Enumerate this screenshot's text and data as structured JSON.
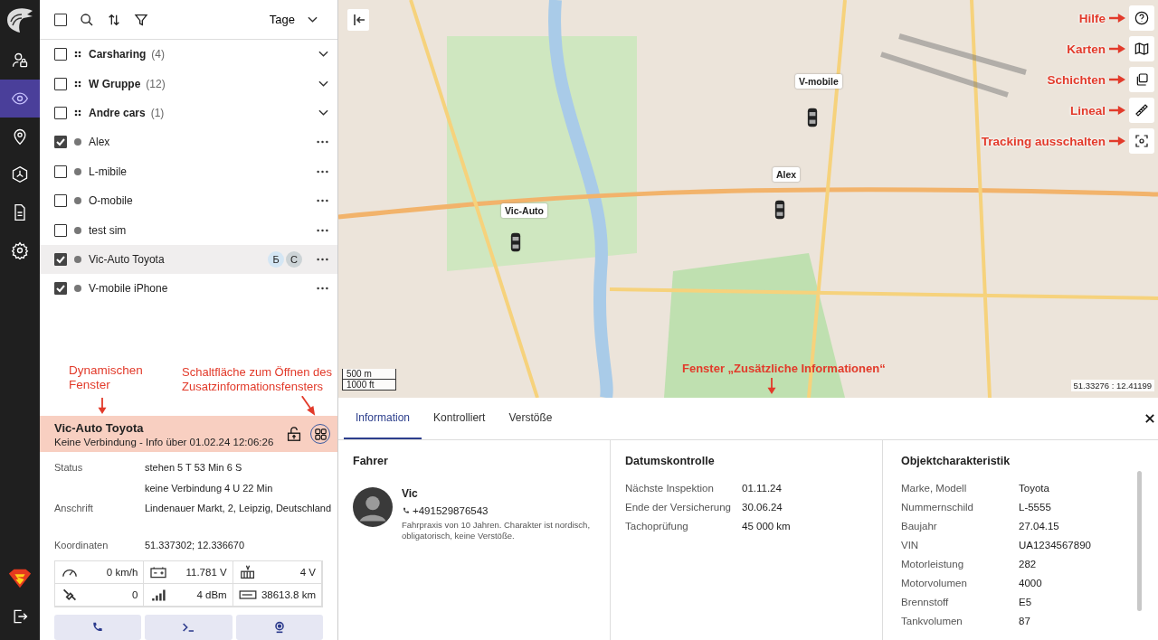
{
  "rail": [
    {
      "kind": "user-lock",
      "selected": false
    },
    {
      "kind": "eye",
      "selected": true
    },
    {
      "kind": "pin",
      "selected": false
    },
    {
      "kind": "hexagon",
      "selected": false
    },
    {
      "kind": "document",
      "selected": false
    },
    {
      "kind": "gear",
      "selected": false
    }
  ],
  "toolbar": {
    "period": "Tage",
    "select_all_checked": false
  },
  "list": [
    {
      "kind": "group",
      "name": "Carsharing",
      "count": "(4)",
      "checked": false,
      "selected": false
    },
    {
      "kind": "group",
      "name": "W Gruppe",
      "count": "(12)",
      "checked": false,
      "selected": false
    },
    {
      "kind": "group",
      "name": "Andre cars",
      "count": "(1)",
      "checked": false,
      "selected": false
    },
    {
      "kind": "unit",
      "name": "Alex",
      "checked": true,
      "selected": false
    },
    {
      "kind": "unit",
      "name": "L-mibile",
      "checked": false,
      "selected": false
    },
    {
      "kind": "unit",
      "name": "O-mobile",
      "checked": false,
      "selected": false
    },
    {
      "kind": "unit",
      "name": "test sim",
      "checked": false,
      "selected": false
    },
    {
      "kind": "unit",
      "name": "Vic-Auto Toyota",
      "checked": true,
      "selected": true,
      "badges": [
        "Б",
        "С"
      ]
    },
    {
      "kind": "unit",
      "name": "V-mobile iPhone",
      "checked": true,
      "selected": false
    }
  ],
  "annotations": {
    "dynamic": "Dynamischen Fenster",
    "button": "Schaltfläche zum Öffnen des Zusatzinformationsfensters",
    "panel": "Fenster „Zusätzliche Informationen“"
  },
  "details": {
    "title": "Vic-Auto Toyota",
    "subtitle": "Keine Verbindung - Info über 01.02.24 12:06:26",
    "rows": [
      {
        "label": "Status",
        "value": "stehen 5 T 53 Min 6 S"
      },
      {
        "value": "keine Verbindung 4 U 22 Min"
      },
      {
        "label": "Anschrift",
        "value": "Lindenauer Markt, 2, Leipzig, Deutschland"
      },
      {
        "label": "Koordinaten",
        "value": "51.337302; 12.336670"
      }
    ],
    "sensors": [
      {
        "kind": "speed",
        "value": "0 km/h"
      },
      {
        "kind": "battery",
        "value": "11.781 V"
      },
      {
        "kind": "voltage",
        "value": "4 V"
      },
      {
        "kind": "satellite",
        "value": "0"
      },
      {
        "kind": "signal",
        "value": "4 dBm"
      },
      {
        "kind": "odometer",
        "value": "38613.8  km"
      }
    ],
    "actions": [
      {
        "kind": "call"
      },
      {
        "kind": "terminal"
      },
      {
        "kind": "camera"
      }
    ]
  },
  "map": {
    "markers": [
      {
        "label": "V-mobile"
      },
      {
        "label": "Alex"
      },
      {
        "label": "Vic-Auto"
      }
    ],
    "scale": [
      "500 m",
      "1000 ft"
    ],
    "coordinates": "51.33276 : 12.41199",
    "controls": [
      {
        "kind": "help",
        "annotation": "Hilfe"
      },
      {
        "kind": "map",
        "annotation": "Karten"
      },
      {
        "kind": "layers",
        "annotation": "Schichten"
      },
      {
        "kind": "ruler",
        "annotation": "Lineal"
      },
      {
        "kind": "focus",
        "annotation": "Tracking ausschalten"
      }
    ]
  },
  "info": {
    "tabs": [
      {
        "label": "Information",
        "selected": true
      },
      {
        "label": "Kontrolliert",
        "selected": false
      },
      {
        "label": "Verstöße",
        "selected": false
      }
    ],
    "driver": {
      "title": "Fahrer",
      "name": "Vic",
      "phone": "+491529876543",
      "note": "Fahrpraxis von 10 Jahren. Charakter ist nordisch, obligatorisch, keine Verstöße."
    },
    "dates": {
      "title": "Datumskontrolle",
      "rows": [
        {
          "label": "Nächste Inspektion",
          "value": "01.11.24"
        },
        {
          "label": "Ende der Versicherung",
          "value": "30.06.24"
        },
        {
          "label": "Tachoprüfung",
          "value": "45 000 km"
        }
      ]
    },
    "object": {
      "title": "Objektcharakteristik",
      "rows": [
        {
          "label": "Marke, Modell",
          "value": "Toyota"
        },
        {
          "label": "Nummernschild",
          "value": "L-5555"
        },
        {
          "label": "Baujahr",
          "value": "27.04.15"
        },
        {
          "label": "VIN",
          "value": "UA1234567890"
        },
        {
          "label": "Motorleistung",
          "value": "282"
        },
        {
          "label": "Motorvolumen",
          "value": "4000"
        },
        {
          "label": "Brennstoff",
          "value": "E5"
        },
        {
          "label": "Tankvolumen",
          "value": "87"
        }
      ]
    }
  }
}
